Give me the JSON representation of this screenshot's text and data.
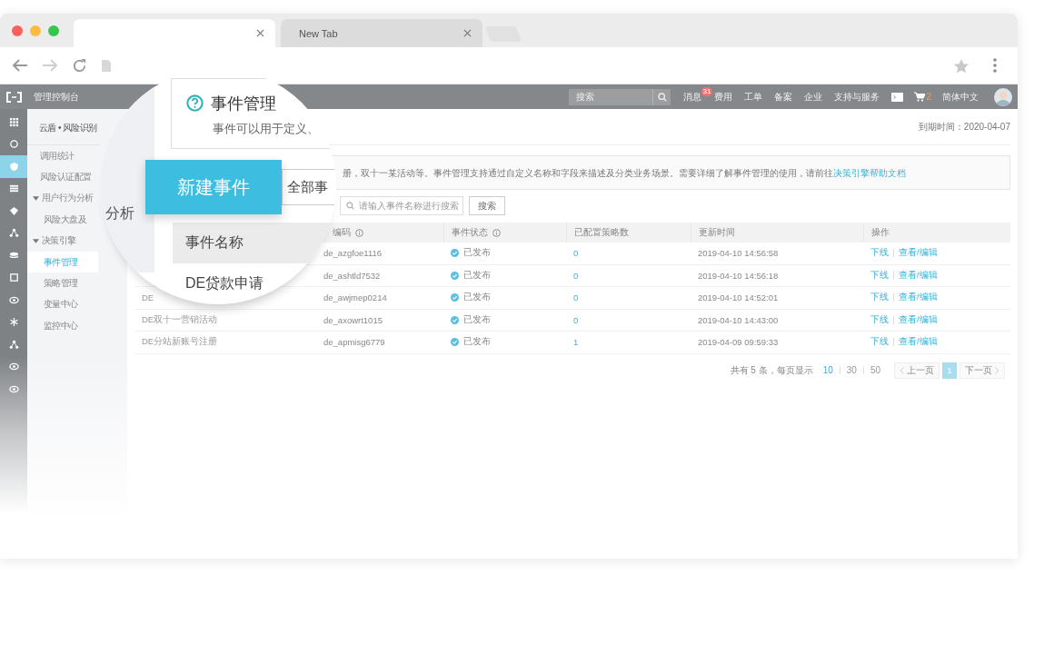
{
  "browser": {
    "tabs": [
      {
        "selected": true
      },
      {
        "label": "New Tab",
        "selected": false
      }
    ]
  },
  "console": {
    "brand": "管理控制台",
    "search": {
      "placeholder": "搜索"
    },
    "nav": [
      {
        "kind": "link",
        "label": "消息",
        "badge": "31"
      },
      {
        "kind": "link",
        "label": "费用"
      },
      {
        "kind": "link",
        "label": "工单"
      },
      {
        "kind": "link",
        "label": "备案"
      },
      {
        "kind": "link",
        "label": "企业"
      },
      {
        "kind": "link",
        "label": "支持与服务"
      },
      {
        "kind": "terminal"
      },
      {
        "kind": "cart",
        "count": "2"
      },
      {
        "kind": "link",
        "label": "简体中文"
      },
      {
        "kind": "avatar"
      }
    ]
  },
  "rail": [
    {
      "selected": false
    },
    {
      "selected": false
    },
    {
      "selected": true
    },
    {
      "selected": false
    },
    {
      "selected": false
    },
    {
      "selected": false
    },
    {
      "selected": false
    },
    {
      "selected": false
    },
    {
      "selected": false
    },
    {
      "selected": false
    },
    {
      "selected": false
    },
    {
      "selected": false
    },
    {
      "selected": false
    }
  ],
  "sidebar": {
    "title": "云盾 • 风险识别",
    "items": [
      {
        "label": "调用统计",
        "selected": false
      },
      {
        "label": "风险认证配置",
        "selected": false
      },
      {
        "label": "用户行为分析",
        "selected": false,
        "expanded": true,
        "children": [
          {
            "label": "风险大盘及",
            "selected": false
          }
        ]
      },
      {
        "label": "决策引擎",
        "selected": false,
        "expanded": true,
        "children": [
          {
            "label": "事件管理",
            "selected": true
          },
          {
            "label": "策略管理",
            "selected": false
          },
          {
            "label": "变量中心",
            "selected": false
          },
          {
            "label": "监控中心",
            "selected": false
          }
        ]
      }
    ]
  },
  "main": {
    "expiry": "到期时间：2020-04-07",
    "notice": {
      "text": "册，双十一某活动等。事件管理支持通过自定义名称和字段来描述及分类业务场景。需要详细了解事件管理的使用，请前往",
      "link": "决策引擎帮助文档"
    },
    "search": {
      "placeholder": "请输入事件名称进行搜索",
      "button": "搜索"
    },
    "table": {
      "columns": [
        {},
        {
          "label": "编码",
          "info": true
        },
        {
          "label": "事件状态",
          "info": true
        },
        {
          "label": "已配置策略数"
        },
        {
          "label": "更新时间"
        },
        {
          "label": "操作"
        }
      ],
      "rows": [
        {
          "code": "de_azgfoe1116",
          "status": "已发布",
          "strategies": "0",
          "updated": "2019-04-10 14:56:58",
          "actions": [
            "下线",
            "查看/编辑"
          ]
        },
        {
          "code": "de_ashtld7532",
          "status": "已发布",
          "strategies": "0",
          "updated": "2019-04-10 14:56:18",
          "actions": [
            "下线",
            "查看/编辑"
          ]
        },
        {
          "name": "DE",
          "code": "de_awjmep0214",
          "status": "已发布",
          "strategies": "0",
          "updated": "2019-04-10 14:52:01",
          "actions": [
            "下线",
            "查看/编辑"
          ]
        },
        {
          "name": "DE双十一营销活动",
          "code": "de_axowrt1015",
          "status": "已发布",
          "strategies": "0",
          "updated": "2019-04-10 14:43:00",
          "actions": [
            "下线",
            "查看/编辑"
          ]
        },
        {
          "name": "DE分站新账号注册",
          "code": "de_apmisg6779",
          "status": "已发布",
          "strategies": "1",
          "updated": "2019-04-09 09:59:33",
          "actions": [
            "下线",
            "查看/编辑"
          ]
        }
      ]
    },
    "pagination": {
      "summary": "共有 5 条，每页显示",
      "sizes": [
        {
          "label": "10",
          "selected": true
        },
        {
          "label": "30",
          "selected": false
        },
        {
          "label": "50",
          "selected": false
        }
      ],
      "prev": "上一页",
      "pages": [
        {
          "label": "1",
          "selected": true
        }
      ],
      "next": "下一页"
    }
  },
  "magnifier": {
    "sidebar_text": "分析",
    "title": "事件管理",
    "subtitle": "事件可以用于定义、",
    "buttons": [
      {
        "kind": "primary",
        "label": "新建事件"
      },
      {
        "kind": "default",
        "label": "全部事"
      }
    ],
    "column": "事件名称",
    "row": "DE贷款申请"
  }
}
